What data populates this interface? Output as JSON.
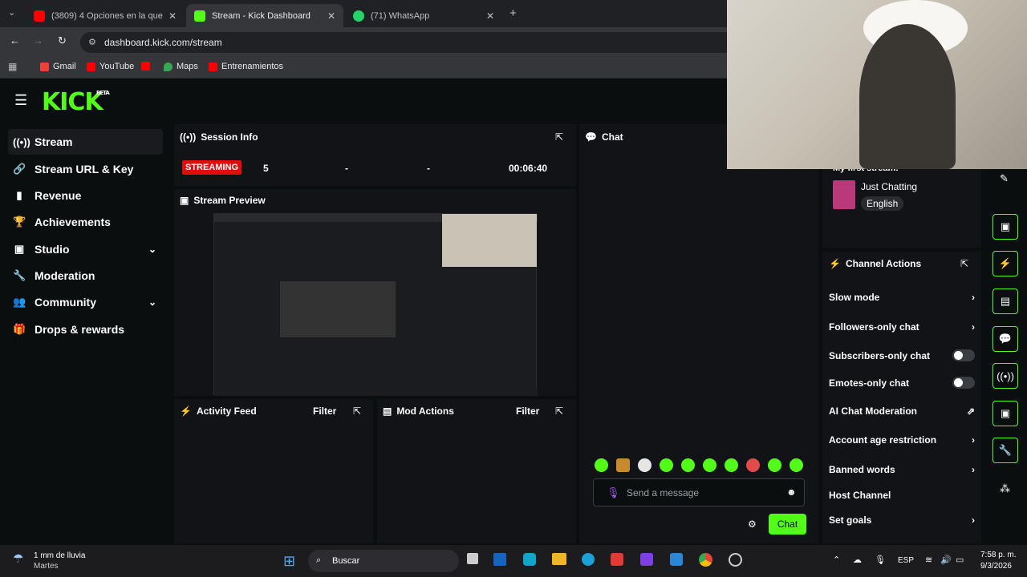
{
  "browser": {
    "tabs": [
      {
        "title": "(3809) 4 Opciones en la que pu",
        "favicon_color": "#ff0000"
      },
      {
        "title": "Stream - Kick Dashboard",
        "favicon_color": "#53fc18"
      },
      {
        "title": "(71) WhatsApp",
        "favicon_color": "#25d366"
      }
    ],
    "new_tab": "+",
    "url": "dashboard.kick.com/stream",
    "bookmarks": [
      "Gmail",
      "YouTube",
      "Maps",
      "Entrenamientos"
    ]
  },
  "logo": {
    "text": "KICK",
    "badge": "BETA"
  },
  "sidebar": {
    "items": [
      {
        "label": "Stream",
        "icon": "broadcast-icon"
      },
      {
        "label": "Stream URL & Key",
        "icon": "link-icon"
      },
      {
        "label": "Revenue",
        "icon": "chart-icon"
      },
      {
        "label": "Achievements",
        "icon": "trophy-icon"
      },
      {
        "label": "Studio",
        "icon": "studio-icon"
      },
      {
        "label": "Moderation",
        "icon": "wrench-icon"
      },
      {
        "label": "Community",
        "icon": "community-icon"
      },
      {
        "label": "Drops & rewards",
        "icon": "gift-icon"
      }
    ]
  },
  "session": {
    "title": "Session Info",
    "status": "STREAMING",
    "viewers": "5",
    "stat2": "-",
    "stat3": "-",
    "duration": "00:06:40"
  },
  "preview": {
    "title": "Stream Preview"
  },
  "activity": {
    "title": "Activity Feed",
    "filter": "Filter"
  },
  "mod_actions": {
    "title": "Mod Actions",
    "filter": "Filter"
  },
  "chat": {
    "title": "Chat",
    "placeholder": "Send a message",
    "send_label": "Chat"
  },
  "stream_info": {
    "title": "My first stream!",
    "category": "Just Chatting",
    "language": "English"
  },
  "channel_actions": {
    "title": "Channel Actions",
    "items": [
      {
        "label": "Slow mode",
        "control": "chevron"
      },
      {
        "label": "Followers-only chat",
        "control": "chevron"
      },
      {
        "label": "Subscribers-only chat",
        "control": "toggle"
      },
      {
        "label": "Emotes-only chat",
        "control": "toggle"
      },
      {
        "label": "AI Chat Moderation",
        "control": "external"
      },
      {
        "label": "Account age restriction",
        "control": "chevron"
      },
      {
        "label": "Banned words",
        "control": "chevron"
      },
      {
        "label": "Host Channel",
        "control": "none"
      },
      {
        "label": "Set goals",
        "control": "chevron"
      }
    ]
  },
  "taskbar": {
    "weather": "1 mm de lluvia",
    "weather_sub": "Martes",
    "search": "Buscar",
    "lang": "ESP",
    "time": "7:58 p. m.",
    "date": "9/3/2026"
  },
  "colors": {
    "accent": "#53fc18",
    "live": "#e30c0c"
  }
}
